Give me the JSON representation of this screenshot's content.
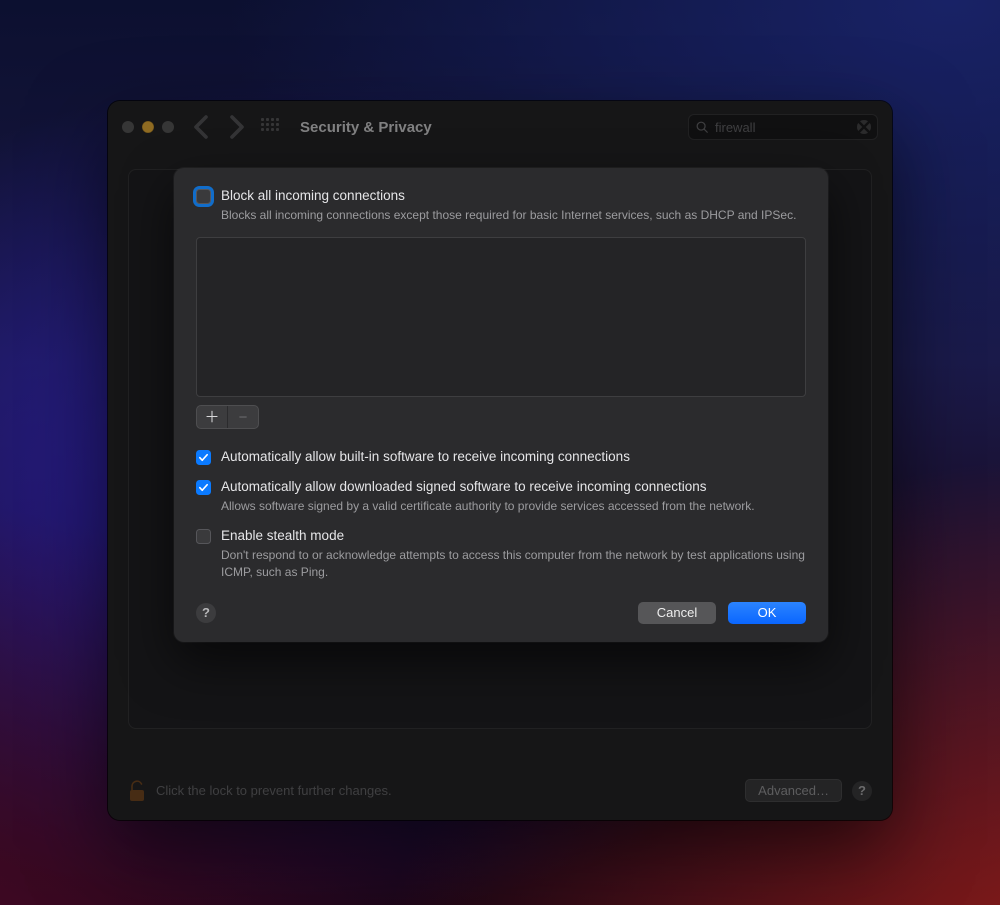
{
  "window": {
    "title": "Security & Privacy",
    "search_value": "firewall"
  },
  "footer": {
    "lock_message": "Click the lock to prevent further changes.",
    "advanced_label": "Advanced…"
  },
  "sheet": {
    "block_all": {
      "checked": false,
      "label": "Block all incoming connections",
      "desc": "Blocks all incoming connections except those required for basic Internet services, such as DHCP and IPSec."
    },
    "allow_builtin": {
      "checked": true,
      "label": "Automatically allow built-in software to receive incoming connections"
    },
    "allow_signed": {
      "checked": true,
      "label": "Automatically allow downloaded signed software to receive incoming connections",
      "desc": "Allows software signed by a valid certificate authority to provide services accessed from the network."
    },
    "stealth": {
      "checked": false,
      "label": "Enable stealth mode",
      "desc": "Don't respond to or acknowledge attempts to access this computer from the network by test applications using ICMP, such as Ping."
    },
    "cancel_label": "Cancel",
    "ok_label": "OK"
  }
}
